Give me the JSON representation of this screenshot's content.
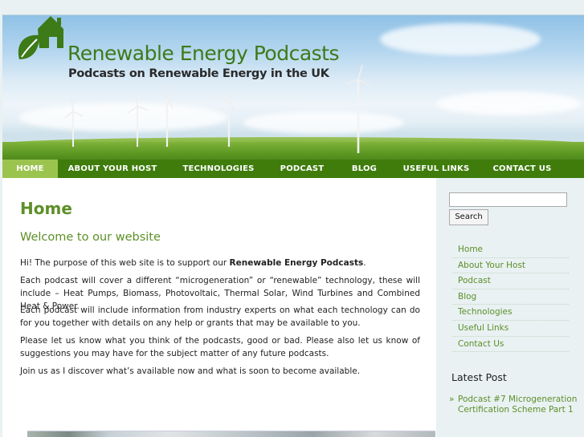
{
  "header": {
    "title": "Renewable Energy Podcasts",
    "tagline": "Podcasts on Renewable Energy in the UK"
  },
  "nav": {
    "items": [
      {
        "label": "HOME",
        "active": true
      },
      {
        "label": "ABOUT YOUR HOST",
        "active": false
      },
      {
        "label": "TECHNOLOGIES",
        "active": false
      },
      {
        "label": "PODCAST",
        "active": false
      },
      {
        "label": "BLOG",
        "active": false
      },
      {
        "label": "USEFUL LINKS",
        "active": false
      },
      {
        "label": "CONTACT US",
        "active": false
      }
    ]
  },
  "content": {
    "heading": "Home",
    "subheading": "Welcome to our website",
    "p1_start": "Hi! The purpose of this web site is to support our ",
    "p1_bold": "Renewable Energy Podcasts",
    "p1_end": ".",
    "p2": "Each podcast will cover a different “microgeneration” or “renewable” technology, these will include – Heat Pumps, Biomass, Photovoltaic, Thermal Solar, Wind Turbines and Combined Heat & Power.",
    "p3": "Each podcast will include information from industry experts on what each technology can do for you together with details on any help or grants that may be available to you.",
    "p4": "Please let us know what you think of the podcasts, good or bad. Please also let us know of suggestions you may have for the subject matter of any future podcasts.",
    "p5": "Join us as I discover what’s available now and what is soon to become available."
  },
  "sidebar": {
    "search_value": "",
    "search_button": "Search",
    "menu": [
      "Home",
      "About Your Host",
      "Podcast",
      "Blog",
      "Technologies",
      "Useful Links",
      "Contact Us"
    ],
    "latest_title": "Latest Post",
    "latest_bullet": "»",
    "latest_post": "Podcast #7 Microgeneration Certification Scheme Part 1"
  },
  "colors": {
    "nav_bg": "#3f7c0c",
    "nav_active": "#9bc44f",
    "accent_green": "#5d8f27",
    "logo_green": "#3d7a18"
  }
}
